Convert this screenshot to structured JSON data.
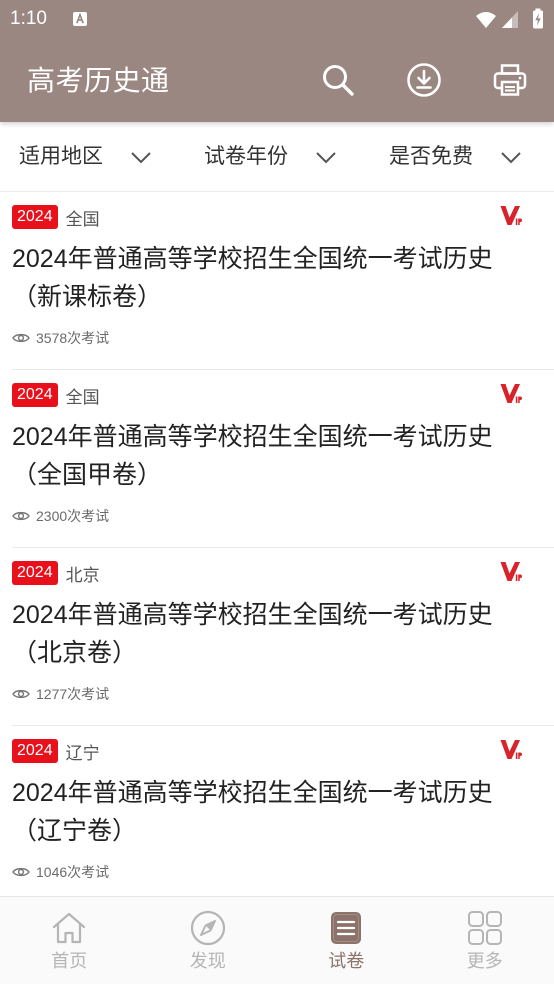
{
  "status_bar": {
    "time": "1:10",
    "icons": [
      "notification-a-icon",
      "wifi-icon",
      "signal-icon",
      "battery-charging-icon"
    ]
  },
  "app_bar": {
    "title": "高考历史通",
    "actions": [
      {
        "icon": "search-icon"
      },
      {
        "icon": "download-icon"
      },
      {
        "icon": "print-icon"
      }
    ]
  },
  "filters": [
    {
      "label": "适用地区",
      "icon": "chevron-down-icon"
    },
    {
      "label": "试卷年份",
      "icon": "chevron-down-icon"
    },
    {
      "label": "是否免费",
      "icon": "chevron-down-icon"
    }
  ],
  "papers": [
    {
      "year": "2024",
      "region": "全国",
      "title": "2024年普通高等学校招生全国统一考试历史（新课标卷）",
      "views": "3578次考试",
      "vip": true
    },
    {
      "year": "2024",
      "region": "全国",
      "title": "2024年普通高等学校招生全国统一考试历史（全国甲卷）",
      "views": "2300次考试",
      "vip": true
    },
    {
      "year": "2024",
      "region": "北京",
      "title": "2024年普通高等学校招生全国统一考试历史（北京卷）",
      "views": "1277次考试",
      "vip": true
    },
    {
      "year": "2024",
      "region": "辽宁",
      "title": "2024年普通高等学校招生全国统一考试历史（辽宁卷）",
      "views": "1046次考试",
      "vip": true
    }
  ],
  "bottom_nav": {
    "items": [
      {
        "label": "首页",
        "icon": "home-icon",
        "selected": false
      },
      {
        "label": "发现",
        "icon": "compass-icon",
        "selected": false
      },
      {
        "label": "试卷",
        "icon": "paper-icon",
        "selected": true
      },
      {
        "label": "更多",
        "icon": "grid-icon",
        "selected": false
      }
    ]
  },
  "colors": {
    "primary": "#9b8782",
    "year_badge": "#e8101a",
    "vip": "#d8232a",
    "nav_selected": "#8b736a",
    "nav_inactive": "#b5b5b5"
  }
}
